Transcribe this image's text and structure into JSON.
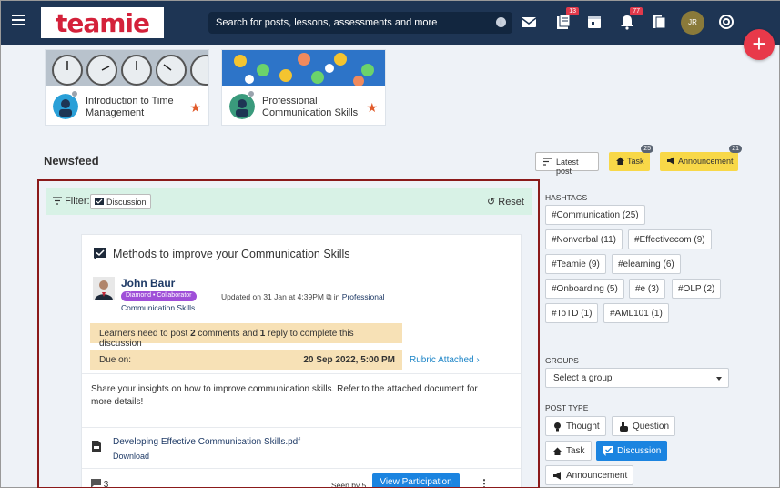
{
  "header": {
    "logo_text": "teamie",
    "search_placeholder": "Search for posts, lessons, assessments and more",
    "lessons_badge": "13",
    "notifications_badge": "77",
    "avatar_initials": "JR"
  },
  "courses": [
    {
      "title": "Introduction to Time Management"
    },
    {
      "title": "Professional Communication Skills"
    }
  ],
  "newsfeed": {
    "title": "Newsfeed",
    "latest_post_label": "Latest post",
    "task_label": "Task",
    "task_count": "25",
    "announcement_label": "Announcement",
    "announcement_count": "21"
  },
  "filter": {
    "label": "Filter:",
    "chip": "Discussion",
    "reset": "Reset"
  },
  "post": {
    "title": "Methods to improve your Communication Skills",
    "author": "John Baur",
    "role": "Diamond • Collaborator",
    "updated": "Updated on 31 Jan at 4:39PM",
    "in_text": "in",
    "group_part1": "Professional",
    "group_part2": "Communication Skills",
    "requirement_pre": "Learners need to post ",
    "requirement_num1": "2",
    "requirement_mid": " comments and ",
    "requirement_num2": "1",
    "requirement_post": " reply to complete this discussion",
    "due_label": "Due on:",
    "due_date": "20 Sep 2022, 5:00 PM",
    "rubric": "Rubric Attached",
    "description": "Share your insights on how to improve communication skills. Refer to the attached document for more details!",
    "file_name": "Developing Effective Communication Skills.pdf",
    "download": "Download",
    "comments": "3",
    "seen_by": "Seen by 5",
    "view_participation": "View Participation"
  },
  "sidebar": {
    "hashtags_heading": "HASHTAGS",
    "hashtags": [
      "#Communication (25)",
      "#Nonverbal (11)",
      "#Effectivecom (9)",
      "#Teamie (9)",
      "#elearning (6)",
      "#Onboarding (5)",
      "#e (3)",
      "#OLP (2)",
      "#ToTD (1)",
      "#AML101 (1)"
    ],
    "groups_heading": "GROUPS",
    "group_select": "Select a group",
    "post_type_heading": "POST TYPE",
    "post_types": [
      "Thought",
      "Question",
      "Task",
      "Discussion",
      "Announcement"
    ]
  },
  "colors": {
    "topbar": "#1e3554",
    "brand_red": "#d4213a",
    "accent_blue": "#1b84e0",
    "highlight_border": "#8b1a1a",
    "filter_bg": "#d8f2e6",
    "warning_bg": "#f7e1b6",
    "task_yellow": "#f8d848",
    "role_purple": "#9f4fd8"
  }
}
